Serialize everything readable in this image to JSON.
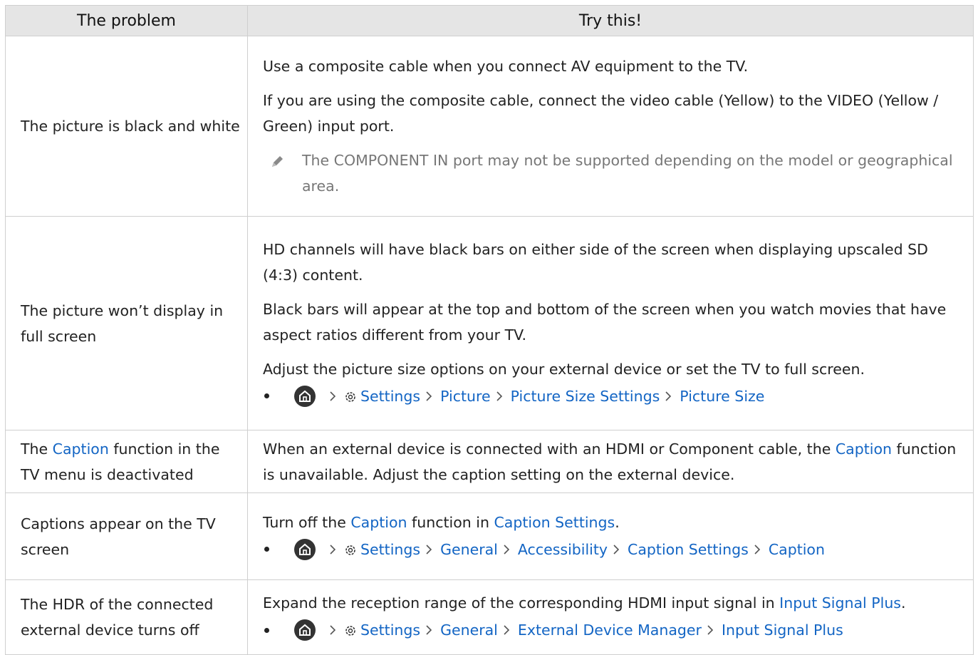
{
  "table": {
    "header": {
      "problem": "The problem",
      "solution": "Try this!"
    },
    "rows": [
      {
        "problem": "The picture is black and white",
        "paragraphs": [
          "Use a composite cable when you connect AV equipment to the TV.",
          "If you are using the composite cable, connect the video cable (Yellow) to the VIDEO (Yellow / Green) input port."
        ],
        "note": "The COMPONENT IN port may not be supported depending on the model or geographical area."
      },
      {
        "problem": "The picture won’t display in full screen",
        "paragraphs": [
          "HD channels will have black bars on either side of the screen when displaying upscaled SD (4:3) content.",
          "Black bars will appear at the top and bottom of the screen when you watch movies that have aspect ratios different from your TV.",
          "Adjust the picture size options on your external device or set the TV to full screen."
        ],
        "path": [
          "Settings",
          "Picture",
          "Picture Size Settings",
          "Picture Size"
        ]
      },
      {
        "problem_pre": "The ",
        "problem_link": "Caption",
        "problem_post": " function in the TV menu is deactivated",
        "sol_pre": "When an external device is connected with an HDMI or Component cable, the ",
        "sol_link": "Caption",
        "sol_post": " function is unavailable. Adjust the caption setting on the external device."
      },
      {
        "problem": "Captions appear on the TV screen",
        "sol_pre": "Turn off the ",
        "sol_link1": "Caption",
        "sol_mid": " function in ",
        "sol_link2": "Caption Settings",
        "sol_post": ".",
        "path": [
          "Settings",
          "General",
          "Accessibility",
          "Caption Settings",
          "Caption"
        ]
      },
      {
        "problem": "The HDR of the connected external device turns off",
        "sol_pre": "Expand the reception range of the corresponding HDMI input signal in ",
        "sol_link": "Input Signal Plus",
        "sol_post": ".",
        "path": [
          "Settings",
          "General",
          "External Device Manager",
          "Input Signal Plus"
        ]
      }
    ]
  },
  "colors": {
    "link": "#1365c4",
    "header_bg": "#e5e5e5",
    "note": "#777777",
    "border": "#cfcfcf"
  },
  "icons": [
    "home-icon",
    "gear-icon",
    "chevron-right-icon",
    "pencil-note-icon"
  ]
}
